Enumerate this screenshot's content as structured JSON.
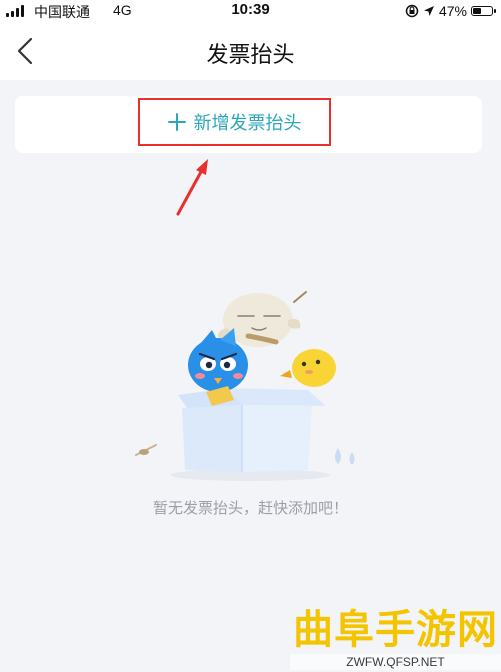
{
  "status_bar": {
    "carrier": "中国联通",
    "network": "4G",
    "time": "10:39",
    "battery": "47%",
    "battery_level": 0.47
  },
  "nav": {
    "title": "发票抬头",
    "back_icon": "chevron-left-icon"
  },
  "add_card": {
    "label": "新增发票抬头",
    "icon": "plus-icon",
    "highlight_color": "#e8302c",
    "accent_color": "#2ba7b8"
  },
  "empty_state": {
    "message": "暂无发票抬头，赶快添加吧！"
  },
  "watermark": {
    "title": "曲阜手游网",
    "url": "ZWFW.QFSP.NET"
  }
}
